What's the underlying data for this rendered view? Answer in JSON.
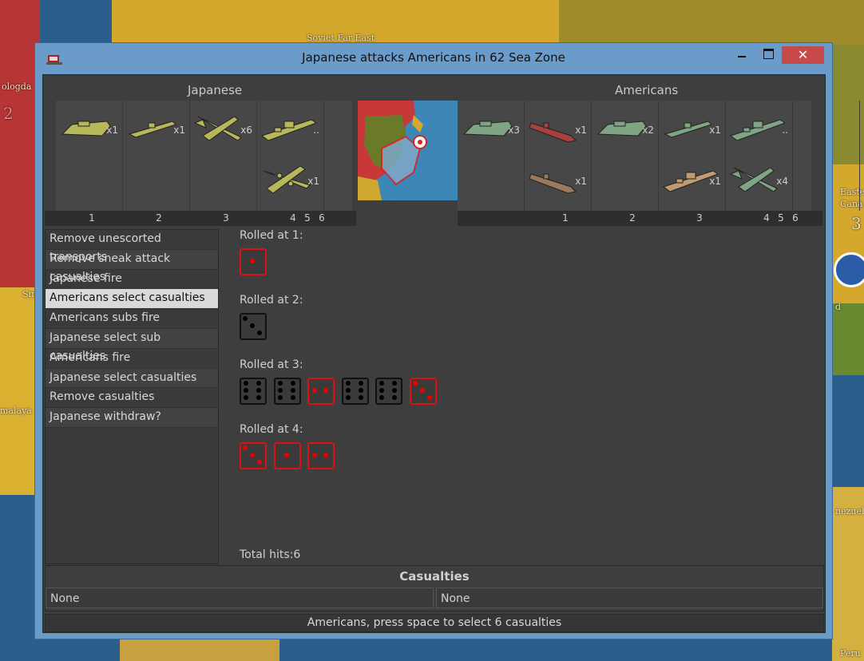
{
  "window": {
    "title": "Japanese attacks Americans in 62 Sea Zone",
    "close_glyph": "✕"
  },
  "map_labels": {
    "top_center": "Soviet Far East",
    "left_top": "ologda",
    "left_num": "2",
    "left_mid": "Sir",
    "left_bottom": "malaya",
    "right_top_1": "Easte",
    "right_top_2": "Cana",
    "right_num": "3",
    "right_mid": "d",
    "right_bottom_1": "nezuel",
    "right_bottom_2": "Peru"
  },
  "attacker": {
    "name": "Japanese",
    "units": [
      {
        "col": 0,
        "row": 0,
        "type": "transport",
        "count": "x1"
      },
      {
        "col": 1,
        "row": 0,
        "type": "destroyer",
        "count": "x1"
      },
      {
        "col": 2,
        "row": 0,
        "type": "fighter",
        "count": "x6"
      },
      {
        "col": 3,
        "row": 0,
        "type": "battleship",
        "count": ".."
      },
      {
        "col": 3,
        "row": 1,
        "type": "bomber",
        "count": "x1"
      }
    ],
    "columns": [
      "1",
      "2",
      "3",
      "4",
      "5",
      "6"
    ]
  },
  "defender": {
    "name": "Americans",
    "units": [
      {
        "col": 0,
        "row": 0,
        "type": "transport",
        "count": "x3"
      },
      {
        "col": 1,
        "row": 0,
        "type": "submarine",
        "count": "x1"
      },
      {
        "col": 1,
        "row": 1,
        "type": "submarine",
        "count": "x1"
      },
      {
        "col": 2,
        "row": 0,
        "type": "transport",
        "count": "x2"
      },
      {
        "col": 3,
        "row": 0,
        "type": "destroyer",
        "count": "x1"
      },
      {
        "col": 3,
        "row": 1,
        "type": "battleship",
        "count": "x1"
      },
      {
        "col": 4,
        "row": 0,
        "type": "battleship",
        "count": ".."
      },
      {
        "col": 4,
        "row": 1,
        "type": "fighter",
        "count": "x4"
      }
    ],
    "columns": [
      "1",
      "2",
      "3",
      "4",
      "5",
      "6"
    ]
  },
  "colors": {
    "japanese_unit": "#b8b85a",
    "american_unit": "#7fa585",
    "american_sub_red": "#a84040",
    "american_sub_brown": "#9a7a5a",
    "american_bb_tan": "#c09a72",
    "die_hit": "#dd1111",
    "selected_step": "#d9d9d9"
  },
  "steps": [
    {
      "label": "Remove unescorted transports",
      "selected": false
    },
    {
      "label": "Remove sneak attack casualties",
      "selected": false
    },
    {
      "label": "Japanese fire",
      "selected": false
    },
    {
      "label": "Americans select casualties",
      "selected": true
    },
    {
      "label": "Americans subs fire",
      "selected": false
    },
    {
      "label": "Japanese select sub casualties",
      "selected": false
    },
    {
      "label": "Americans fire",
      "selected": false
    },
    {
      "label": "Japanese select casualties",
      "selected": false
    },
    {
      "label": "Remove casualties",
      "selected": false
    },
    {
      "label": "Japanese withdraw?",
      "selected": false
    }
  ],
  "rolls": [
    {
      "label": "Rolled at 1:",
      "dice": [
        {
          "value": 1,
          "hit": true
        }
      ]
    },
    {
      "label": "Rolled at 2:",
      "dice": [
        {
          "value": 3,
          "hit": false
        }
      ]
    },
    {
      "label": "Rolled at 3:",
      "dice": [
        {
          "value": 6,
          "hit": false
        },
        {
          "value": 6,
          "hit": false
        },
        {
          "value": 2,
          "hit": true
        },
        {
          "value": 6,
          "hit": false
        },
        {
          "value": 6,
          "hit": false
        },
        {
          "value": 3,
          "hit": true
        }
      ]
    },
    {
      "label": "Rolled at 4:",
      "dice": [
        {
          "value": 3,
          "hit": true
        },
        {
          "value": 1,
          "hit": true
        },
        {
          "value": 2,
          "hit": true
        }
      ]
    }
  ],
  "total_hits": "Total hits:6",
  "casualties": {
    "title": "Casualties",
    "left": "None",
    "right": "None"
  },
  "status": "Americans, press space to select 6 casualties"
}
